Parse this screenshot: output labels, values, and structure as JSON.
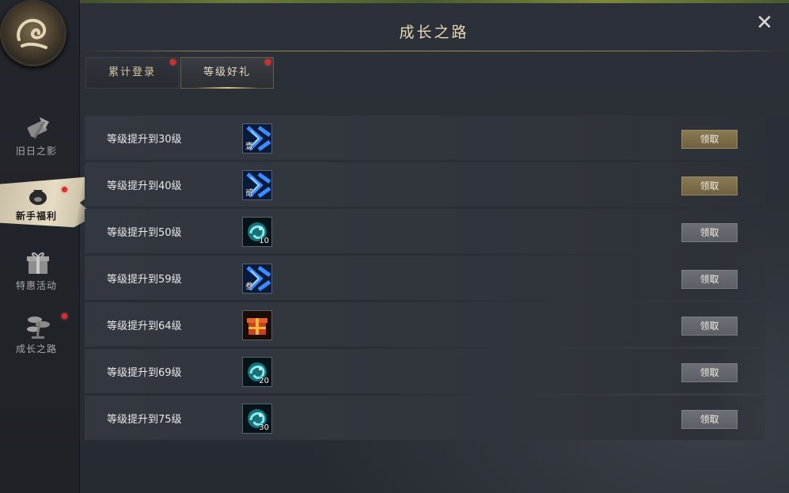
{
  "window": {
    "title": "成长之路",
    "close_glyph": "✕"
  },
  "sidebar": {
    "items": [
      {
        "label": "旧日之影",
        "icon": "axe-scroll-icon",
        "active": false,
        "badge": false
      },
      {
        "label": "新手福利",
        "icon": "money-bag-icon",
        "active": true,
        "badge": true
      },
      {
        "label": "特惠活动",
        "icon": "gift-box-icon",
        "active": false,
        "badge": false
      },
      {
        "label": "成长之路",
        "icon": "bonsai-tree-icon",
        "active": false,
        "badge": true
      }
    ]
  },
  "tabs": [
    {
      "label": "累计登录",
      "active": false,
      "badge": true
    },
    {
      "label": "等级好礼",
      "active": true,
      "badge": true
    }
  ],
  "rewards": [
    {
      "text": "等级提升到30级",
      "item_icon": "blue-claw-icon",
      "mark": "壹",
      "qty": "",
      "button": "领取",
      "button_state": "gold"
    },
    {
      "text": "等级提升到40级",
      "item_icon": "blue-claw-icon",
      "mark": "贰",
      "qty": "",
      "button": "领取",
      "button_state": "gold"
    },
    {
      "text": "等级提升到50级",
      "item_icon": "cyan-spirit-icon",
      "mark": "",
      "qty": "10",
      "button": "领取",
      "button_state": "gray"
    },
    {
      "text": "等级提升到59级",
      "item_icon": "blue-claw-icon",
      "mark": "叁",
      "qty": "",
      "button": "领取",
      "button_state": "gray"
    },
    {
      "text": "等级提升到64级",
      "item_icon": "red-gift-box-icon",
      "mark": "",
      "qty": "",
      "button": "领取",
      "button_state": "gray"
    },
    {
      "text": "等级提升到69级",
      "item_icon": "cyan-spirit-icon",
      "mark": "",
      "qty": "20",
      "button": "领取",
      "button_state": "gray"
    },
    {
      "text": "等级提升到75级",
      "item_icon": "cyan-spirit-icon",
      "mark": "",
      "qty": "30",
      "button": "领取",
      "button_state": "gray"
    }
  ],
  "colors": {
    "accent_gold": "#8b7a55",
    "title_text": "#e7d9b5",
    "badge_red": "#d32f2f",
    "button_gray": "#6d7077"
  }
}
